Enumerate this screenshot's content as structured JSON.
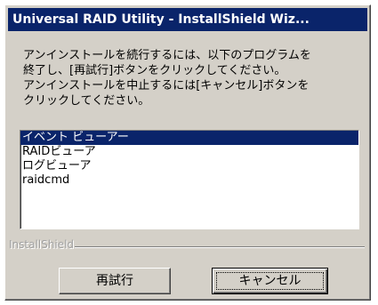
{
  "window": {
    "title": "Universal RAID Utility - InstallShield Wiz..."
  },
  "message": {
    "lines": [
      "アンインストールを続行するには、以下のプログラムを",
      "終了し、[再試行]ボタンをクリックしてください。",
      "アンインストールを中止するには[キャンセル]ボタンを",
      "クリックしてください。"
    ]
  },
  "program_list": {
    "items": [
      "イベント ビューアー",
      "RAIDビューア",
      "ログビューア",
      "raidcmd"
    ],
    "selected_index": 0
  },
  "footer": {
    "brand": "InstallShield"
  },
  "buttons": {
    "retry_label": "再試行",
    "cancel_label": "キャンセル"
  },
  "colors": {
    "titlebar": "#0a246a",
    "face": "#d4d0c8",
    "selection": "#0a246a"
  }
}
